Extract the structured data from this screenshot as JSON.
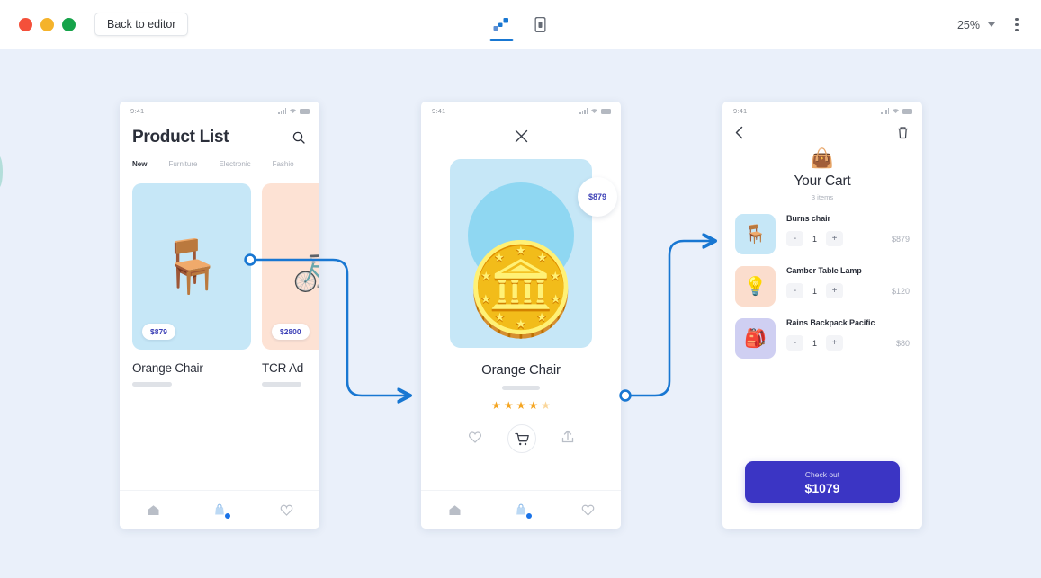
{
  "topbar": {
    "back_label": "Back to editor",
    "zoom_level": "25%",
    "tools": [
      {
        "name": "flow-view",
        "active": true
      },
      {
        "name": "device-view",
        "active": false
      }
    ],
    "accent_color": "#1877d2"
  },
  "screens": [
    {
      "id": "product-list",
      "status": {
        "time": "9:41"
      },
      "title": "Product List",
      "search_icon": "search-icon",
      "tabs": [
        {
          "label": "New",
          "active": true
        },
        {
          "label": "Furniture",
          "active": false
        },
        {
          "label": "Electronic",
          "active": false
        },
        {
          "label": "Fashio",
          "active": false
        }
      ],
      "products": [
        {
          "name": "Orange Chair",
          "price": "$879",
          "swatch": "#c6e7f7",
          "emoji": "🪑"
        },
        {
          "name": "TCR Ad",
          "price": "$2800",
          "swatch": "#fde2d4",
          "emoji": "🚲"
        }
      ],
      "tabbar": [
        {
          "icon": "home-icon",
          "badge": false
        },
        {
          "icon": "bag-icon",
          "badge": true
        },
        {
          "icon": "heart-icon",
          "badge": false
        }
      ]
    },
    {
      "id": "product-detail",
      "status": {
        "time": "9:41"
      },
      "close_icon": "close-icon",
      "price_badge": "$879",
      "name": "Orange Chair",
      "rating": 4.5,
      "stars": [
        "★",
        "★",
        "★",
        "★",
        "★"
      ],
      "actions": [
        {
          "icon": "heart-icon",
          "primary": false
        },
        {
          "icon": "cart-icon",
          "primary": true
        },
        {
          "icon": "share-icon",
          "primary": false
        }
      ],
      "tabbar": [
        {
          "icon": "home-icon",
          "badge": false
        },
        {
          "icon": "bag-icon",
          "badge": true
        },
        {
          "icon": "heart-icon",
          "badge": false
        }
      ]
    },
    {
      "id": "cart",
      "status": {
        "time": "9:41"
      },
      "back_icon": "chevron-left-icon",
      "trash_icon": "trash-icon",
      "bag_emoji": "👜",
      "title": "Your Cart",
      "item_count": "3 items",
      "items": [
        {
          "name": "Burns chair",
          "qty": "1",
          "price": "$879",
          "minus": "-",
          "plus": "+",
          "swatch": "#c6e7f7",
          "emoji": "🪑"
        },
        {
          "name": "Camber Table Lamp",
          "qty": "1",
          "price": "$120",
          "minus": "-",
          "plus": "+",
          "swatch": "#fbddcd",
          "emoji": "💡"
        },
        {
          "name": "Rains Backpack Pacific",
          "qty": "1",
          "price": "$80",
          "minus": "-",
          "plus": "+",
          "swatch": "#cfcff2",
          "emoji": "🎒"
        }
      ],
      "checkout": {
        "label": "Check out",
        "total": "$1079",
        "color": "#3b35c4"
      }
    }
  ],
  "connectors": [
    {
      "from": "product-list",
      "to": "product-detail",
      "color": "#1877d2"
    },
    {
      "from": "product-detail",
      "to": "cart",
      "color": "#1877d2"
    }
  ]
}
